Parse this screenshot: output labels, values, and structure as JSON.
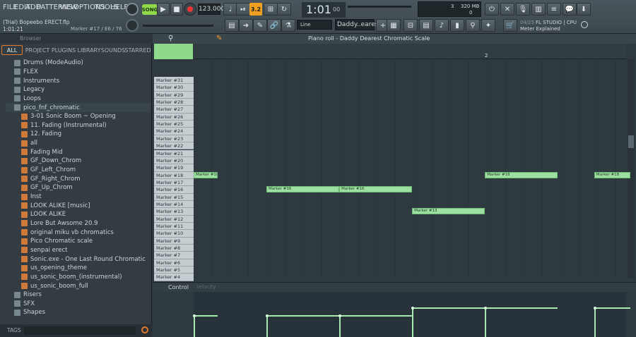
{
  "menu": [
    "FILE",
    "EDIT",
    "ADD",
    "PATTERNS",
    "VIEW",
    "OPTIONS",
    "TOOLS",
    "HELP"
  ],
  "transport": {
    "song_mode": "SONG",
    "tempo": "123.000",
    "time": "1:01",
    "time_sub": "00",
    "pattern_name": "Daddy..earest",
    "snap": "Line",
    "typing_label": "3.2"
  },
  "project": {
    "title": "(Trial) Bopeebo ERECT.flp",
    "position": "1:01:21",
    "marker_info": "Marker #17 / E6 / 76"
  },
  "cpu": {
    "voices": "3",
    "memory": "320 MB",
    "value2": "0"
  },
  "news": {
    "date": "04/25",
    "headline": "FL STUDIO | CPU",
    "sub": "Meter Explained"
  },
  "browser": {
    "title": "Browser",
    "tabs": [
      "ALL",
      "PROJECT",
      "PLUGINS",
      "LIBRARY",
      "SOUNDS",
      "STARRED"
    ],
    "tags_label": "TAGS",
    "items": [
      {
        "label": "Drums (ModeAudio)",
        "type": "folder",
        "indent": 0
      },
      {
        "label": "FLEX",
        "type": "folder",
        "indent": 0
      },
      {
        "label": "Instruments",
        "type": "folder",
        "indent": 0
      },
      {
        "label": "Legacy",
        "type": "folder",
        "indent": 0
      },
      {
        "label": "Loops",
        "type": "folder",
        "indent": 0
      },
      {
        "label": "pico_fnf_chromatic",
        "type": "folder",
        "indent": 0
      },
      {
        "label": "3-01 Sonic Boom ~ Opening",
        "type": "file",
        "indent": 1
      },
      {
        "label": "11. Fading (Instrumental)",
        "type": "file",
        "indent": 1
      },
      {
        "label": "12. Fading",
        "type": "file",
        "indent": 1
      },
      {
        "label": "all",
        "type": "file",
        "indent": 1
      },
      {
        "label": "Fading Mid",
        "type": "file",
        "indent": 1
      },
      {
        "label": "GF_Down_Chrom",
        "type": "file",
        "indent": 1
      },
      {
        "label": "GF_Left_Chrom",
        "type": "file",
        "indent": 1
      },
      {
        "label": "GF_Right_Chrom",
        "type": "file",
        "indent": 1
      },
      {
        "label": "GF_Up_Chrom",
        "type": "file",
        "indent": 1
      },
      {
        "label": "Inst",
        "type": "file",
        "indent": 1
      },
      {
        "label": "LOOK ALIKE [music]",
        "type": "file",
        "indent": 1
      },
      {
        "label": "LOOK ALIKE",
        "type": "file",
        "indent": 1
      },
      {
        "label": "Lore But Awsome 20.9",
        "type": "file",
        "indent": 1
      },
      {
        "label": "original miku vb chromatics",
        "type": "file",
        "indent": 1
      },
      {
        "label": "Pico Chromatic scale",
        "type": "file",
        "indent": 1
      },
      {
        "label": "senpai erect",
        "type": "file",
        "indent": 1
      },
      {
        "label": "Sonic.exe - One Last Round Chromatic",
        "type": "file",
        "indent": 1
      },
      {
        "label": "us_opening_theme",
        "type": "file",
        "indent": 1
      },
      {
        "label": "us_sonic_boom_(instrumental)",
        "type": "file",
        "indent": 1
      },
      {
        "label": "us_sonic_boom_full",
        "type": "file",
        "indent": 1
      },
      {
        "label": "Risers",
        "type": "folder",
        "indent": 0
      },
      {
        "label": "SFX",
        "type": "folder",
        "indent": 0
      },
      {
        "label": "Shapes",
        "type": "folder",
        "indent": 0
      }
    ]
  },
  "piano_roll": {
    "title": "Piano roll - Daddy Dearest Chromatic Scale",
    "bar_labels": [
      "2"
    ],
    "control_label": "Control",
    "control_param": "Velocity",
    "keys": [
      "Marker #31",
      "Marker #30",
      "Marker #29",
      "Marker #28",
      "Marker #27",
      "Marker #26",
      "Marker #25",
      "Marker #24",
      "Marker #23",
      "Marker #22",
      "Marker #21",
      "Marker #20",
      "Marker #19",
      "Marker #18",
      "Marker #17",
      "Marker #16",
      "Marker #15",
      "Marker #14",
      "Marker #13",
      "Marker #12",
      "Marker #11",
      "Marker #10",
      "Marker #9",
      "Marker #8",
      "Marker #7",
      "Marker #6",
      "Marker #5",
      "Marker #4"
    ],
    "notes": [
      {
        "label": "Marker #18",
        "key": "Marker #18",
        "start": 0.0,
        "len": 0.5
      },
      {
        "label": "Marker #16",
        "key": "Marker #16",
        "start": 1.5,
        "len": 1.5
      },
      {
        "label": "Marker #16",
        "key": "Marker #16",
        "start": 3.0,
        "len": 1.5
      },
      {
        "label": "Marker #13",
        "key": "Marker #13",
        "start": 4.5,
        "len": 1.5
      },
      {
        "label": "Marker #18",
        "key": "Marker #18",
        "start": 6.0,
        "len": 1.5
      },
      {
        "label": "Marker #18",
        "key": "Marker #18",
        "start": 8.25,
        "len": 0.75
      }
    ]
  }
}
